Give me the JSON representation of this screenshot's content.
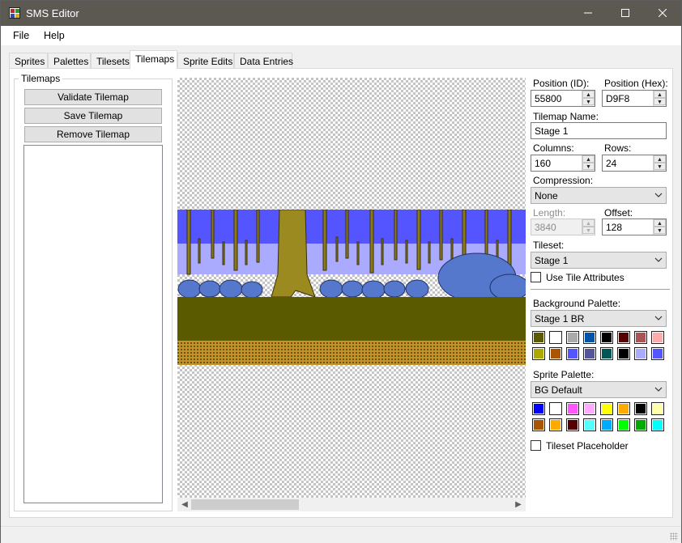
{
  "window": {
    "title": "SMS Editor"
  },
  "menu": [
    "File",
    "Help"
  ],
  "tabs": [
    "Sprites",
    "Palettes",
    "Tilesets",
    "Tilemaps",
    "Sprite Edits",
    "Data Entries"
  ],
  "active_tab": "Tilemaps",
  "left_panel": {
    "group_title": "Tilemaps",
    "buttons": {
      "validate": "Validate Tilemap",
      "save": "Save Tilemap",
      "remove": "Remove Tilemap"
    }
  },
  "props": {
    "position_id_label": "Position (ID):",
    "position_id": "55800",
    "position_hex_label": "Position (Hex):",
    "position_hex": "D9F8",
    "name_label": "Tilemap Name:",
    "name": "Stage 1",
    "columns_label": "Columns:",
    "columns": "160",
    "rows_label": "Rows:",
    "rows": "24",
    "compression_label": "Compression:",
    "compression": "None",
    "length_label": "Length:",
    "length": "3840",
    "offset_label": "Offset:",
    "offset": "128",
    "tileset_label": "Tileset:",
    "tileset": "Stage 1",
    "use_tile_attributes": "Use Tile Attributes",
    "use_tile_attributes_checked": false,
    "bg_palette_label": "Background Palette:",
    "bg_palette": "Stage 1 BR",
    "bg_colors": [
      "#5a5a00",
      "#ffffff",
      "#aaaaaa",
      "#0055aa",
      "#000000",
      "#550000",
      "#aa5555",
      "#ffaaaa",
      "#aaaa00",
      "#aa5500",
      "#5555ff",
      "#555599",
      "#005555",
      "#000000",
      "#aaaaff",
      "#5555ff"
    ],
    "sprite_palette_label": "Sprite Palette:",
    "sprite_palette": "BG Default",
    "sprite_colors": [
      "#0000ff",
      "#ffffff",
      "#ff55ff",
      "#ffaaff",
      "#ffff00",
      "#ffaa00",
      "#000000",
      "#ffffaa",
      "#aa5500",
      "#ffaa00",
      "#550000",
      "#55ffff",
      "#00aaff",
      "#00ff00",
      "#00aa00",
      "#00ffff"
    ],
    "tileset_placeholder": "Tileset Placeholder",
    "tileset_placeholder_checked": false
  },
  "icons": {
    "minimize": "minimize-icon",
    "maximize": "maximize-icon",
    "close": "close-icon"
  }
}
